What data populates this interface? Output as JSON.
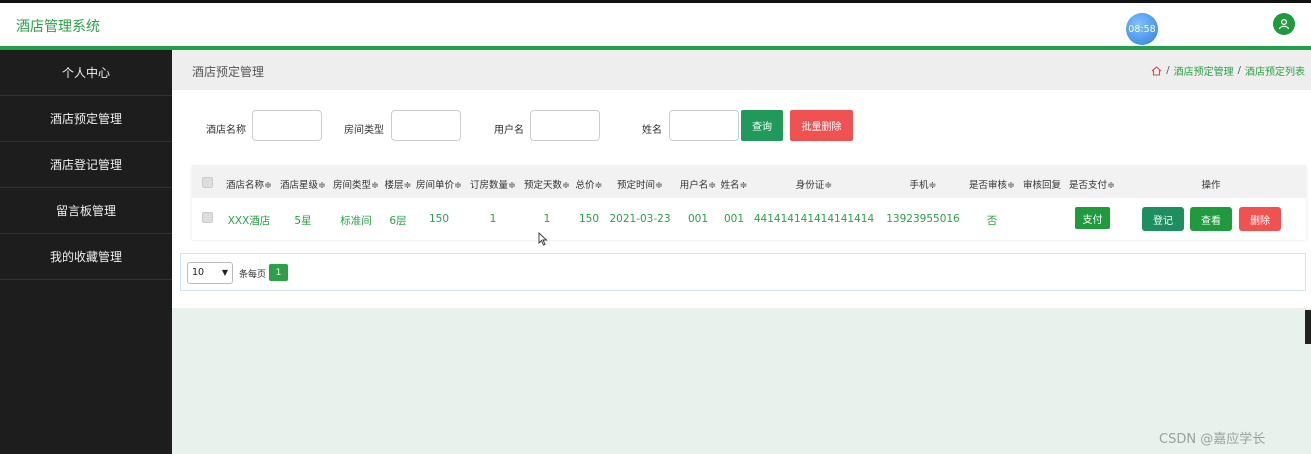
{
  "app": {
    "title": "酒店管理系统",
    "clock": "08:58",
    "user_icon": "user-icon"
  },
  "colors": {
    "brand": "#2aa146",
    "sidebar": "#1d1d1d",
    "danger": "#f05252",
    "register": "#1c8f61"
  },
  "sidebar": {
    "items": [
      {
        "label": "个人中心"
      },
      {
        "label": "酒店预定管理"
      },
      {
        "label": "酒店登记管理"
      },
      {
        "label": "留言板管理"
      },
      {
        "label": "我的收藏管理"
      }
    ]
  },
  "page": {
    "title": "酒店预定管理",
    "breadcrumb": [
      "酒店预定管理",
      "酒店预定列表"
    ],
    "home_icon": "home-icon"
  },
  "search": {
    "hotel_name_label": "酒店名称",
    "room_type_label": "房间类型",
    "username_label": "用户名",
    "name_label": "姓名",
    "hotel_name_value": "",
    "room_type_value": "",
    "username_value": "",
    "name_value": "",
    "query_button": "查询",
    "batch_delete_button": "批量删除"
  },
  "table": {
    "columns": [
      "酒店名称",
      "酒店星级",
      "房间类型",
      "楼层",
      "房间单价",
      "订房数量",
      "预定天数",
      "总价",
      "预定时间",
      "用户名",
      "姓名",
      "身份证",
      "手机",
      "是否审核",
      "审核回复",
      "是否支付",
      "操作"
    ],
    "rows": [
      {
        "hotel_name": "XXX酒店",
        "star": "5星",
        "room_type": "标准间",
        "floor": "6层",
        "price": "150",
        "rooms": "1",
        "days": "1",
        "total": "150",
        "date": "2021-03-23",
        "username": "001",
        "name": "001",
        "id_card": "441414141414141414",
        "phone": "13923955016",
        "approved": "否",
        "reply": "",
        "pay_button": "支付",
        "register_button": "登记",
        "view_button": "查看",
        "delete_button": "删除"
      }
    ]
  },
  "pagination": {
    "page_size": "10",
    "per_page_label": "条每页",
    "current_page": "1"
  },
  "watermark": "CSDN @嘉应学长"
}
